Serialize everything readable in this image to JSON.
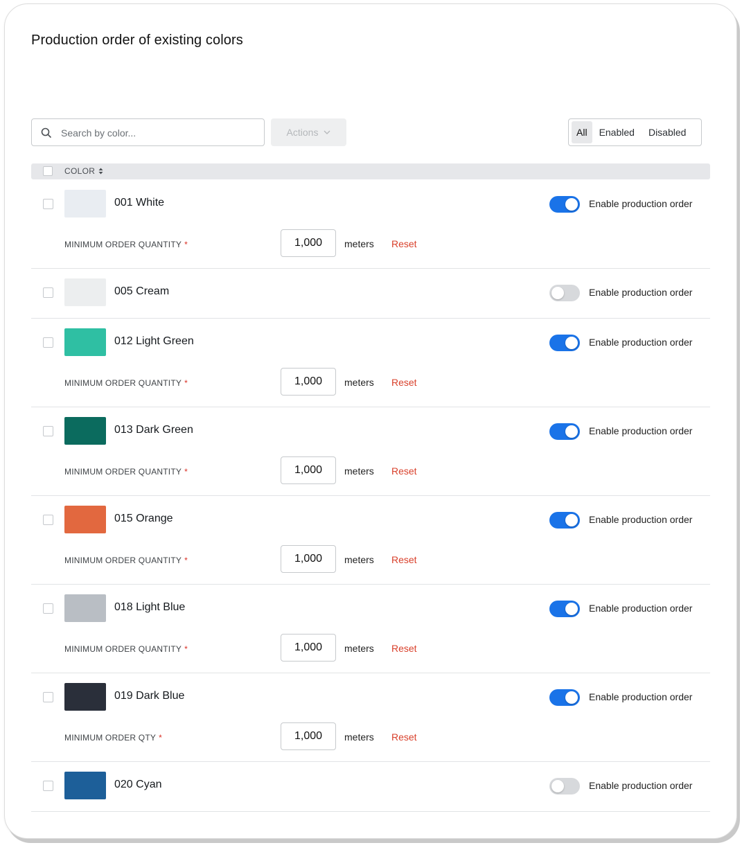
{
  "page": {
    "title": "Production order of existing colors"
  },
  "toolbar": {
    "search_placeholder": "Search by color...",
    "actions_label": "Actions",
    "filters": [
      "All",
      "Enabled",
      "Disabled"
    ],
    "active_filter": "All"
  },
  "table": {
    "column_header": "COLOR",
    "toggle_label": "Enable production order",
    "unit": "meters",
    "reset_label": "Reset",
    "required_mark": "*",
    "rows": [
      {
        "name": "001 White",
        "enabled": true,
        "moq_label": "MINIMUM ORDER QUANTITY",
        "quantity": "1,000",
        "swatch": "#e9edf2"
      },
      {
        "name": "005 Cream",
        "enabled": false,
        "moq_label": "",
        "quantity": "",
        "swatch": "#eceeef"
      },
      {
        "name": "012 Light Green",
        "enabled": true,
        "moq_label": "MINIMUM ORDER QUANTITY",
        "quantity": "1,000",
        "swatch": "#2fbfa3"
      },
      {
        "name": "013 Dark Green",
        "enabled": true,
        "moq_label": "MINIMUM ORDER QUANTITY",
        "quantity": "1,000",
        "swatch": "#0b6b5e"
      },
      {
        "name": "015 Orange",
        "enabled": true,
        "moq_label": "MINIMUM ORDER QUANTITY",
        "quantity": "1,000",
        "swatch": "#e2683f"
      },
      {
        "name": "018 Light Blue",
        "enabled": true,
        "moq_label": "MINIMUM ORDER QUANTITY",
        "quantity": "1,000",
        "swatch": "#b9bec4"
      },
      {
        "name": "019 Dark Blue",
        "enabled": true,
        "moq_label": "MINIMUM ORDER QTY",
        "quantity": "1,000",
        "swatch": "#2a2f3a"
      },
      {
        "name": "020 Cyan",
        "enabled": false,
        "moq_label": "",
        "quantity": "",
        "swatch": "#1d5f99"
      }
    ]
  },
  "colors": {
    "toggle_on": "#1a73e8",
    "toggle_off": "#d7d9dc",
    "reset": "#d9402b",
    "required": "#d93025"
  },
  "icons": {
    "search": "search-icon",
    "actions_chevron": "chevron-down-icon",
    "sort": "sort-icon"
  }
}
